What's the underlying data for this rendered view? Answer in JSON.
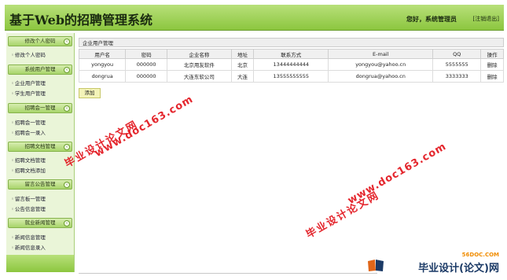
{
  "header": {
    "title": "基于Web的招聘管理系统",
    "welcome": "您好，系统管理员",
    "logout": "[注销退出]"
  },
  "sidebar": {
    "sections": [
      {
        "title": "修改个人密码",
        "items": [
          "修改个人密码"
        ]
      },
      {
        "title": "系统用户管理",
        "items": [
          "企业用户管理",
          "学生用户管理"
        ]
      },
      {
        "title": "招聘会一管理",
        "items": [
          "招聘会一管理",
          "招聘会一录入"
        ]
      },
      {
        "title": "招聘文档管理",
        "items": [
          "招聘文档管理",
          "招聘文档添加"
        ]
      },
      {
        "title": "留言公告管理",
        "items": [
          "留言板一管理",
          "公告信息管理"
        ]
      },
      {
        "title": "就业新闻管理",
        "items": [
          "新闻信息管理",
          "新闻信息录入"
        ]
      }
    ]
  },
  "main": {
    "panel_title": "企业用户管理",
    "columns": [
      "用户名",
      "密码",
      "企业名称",
      "地址",
      "联系方式",
      "E-mail",
      "QQ",
      "操作"
    ],
    "rows": [
      [
        "yongyou",
        "000000",
        "北京用友软件",
        "北京",
        "13444444444",
        "yongyou@yahoo.cn",
        "5555555",
        "删除"
      ],
      [
        "dongrua",
        "000000",
        "大连东软公司",
        "大连",
        "13555555555",
        "dongrua@yahoo.cn",
        "3333333",
        "删除"
      ]
    ],
    "add_label": "添加"
  },
  "watermarks": {
    "url": "www.doc163.com",
    "cn": "毕业设计论文网"
  },
  "logo": {
    "top": "56DOC.COM",
    "text": "毕业设计(论文)网"
  }
}
